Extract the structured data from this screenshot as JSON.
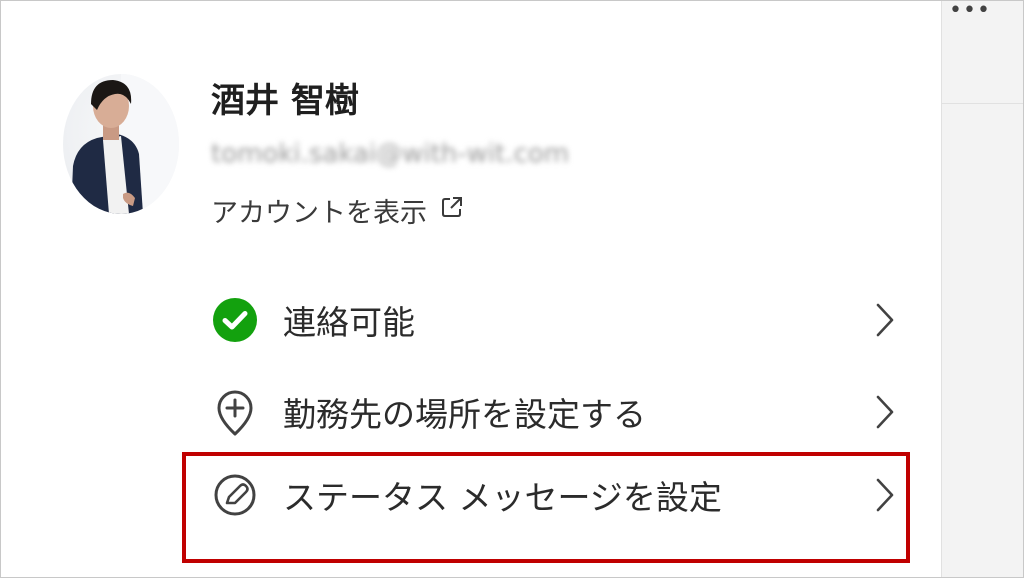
{
  "profile": {
    "name": "酒井 智樹",
    "email": "tomoki.sakai@with-wit.com",
    "view_account": "アカウントを表示"
  },
  "menu": {
    "items": [
      {
        "label": "連絡可能",
        "icon": "available-check-icon"
      },
      {
        "label": "勤務先の場所を設定する",
        "icon": "location-add-icon"
      },
      {
        "label": "ステータス メッセージを設定",
        "icon": "edit-pen-icon"
      }
    ]
  },
  "header": {
    "more_label": "•••"
  },
  "colors": {
    "available": "#13a10e",
    "highlight": "#c00000",
    "text": "#242424"
  }
}
